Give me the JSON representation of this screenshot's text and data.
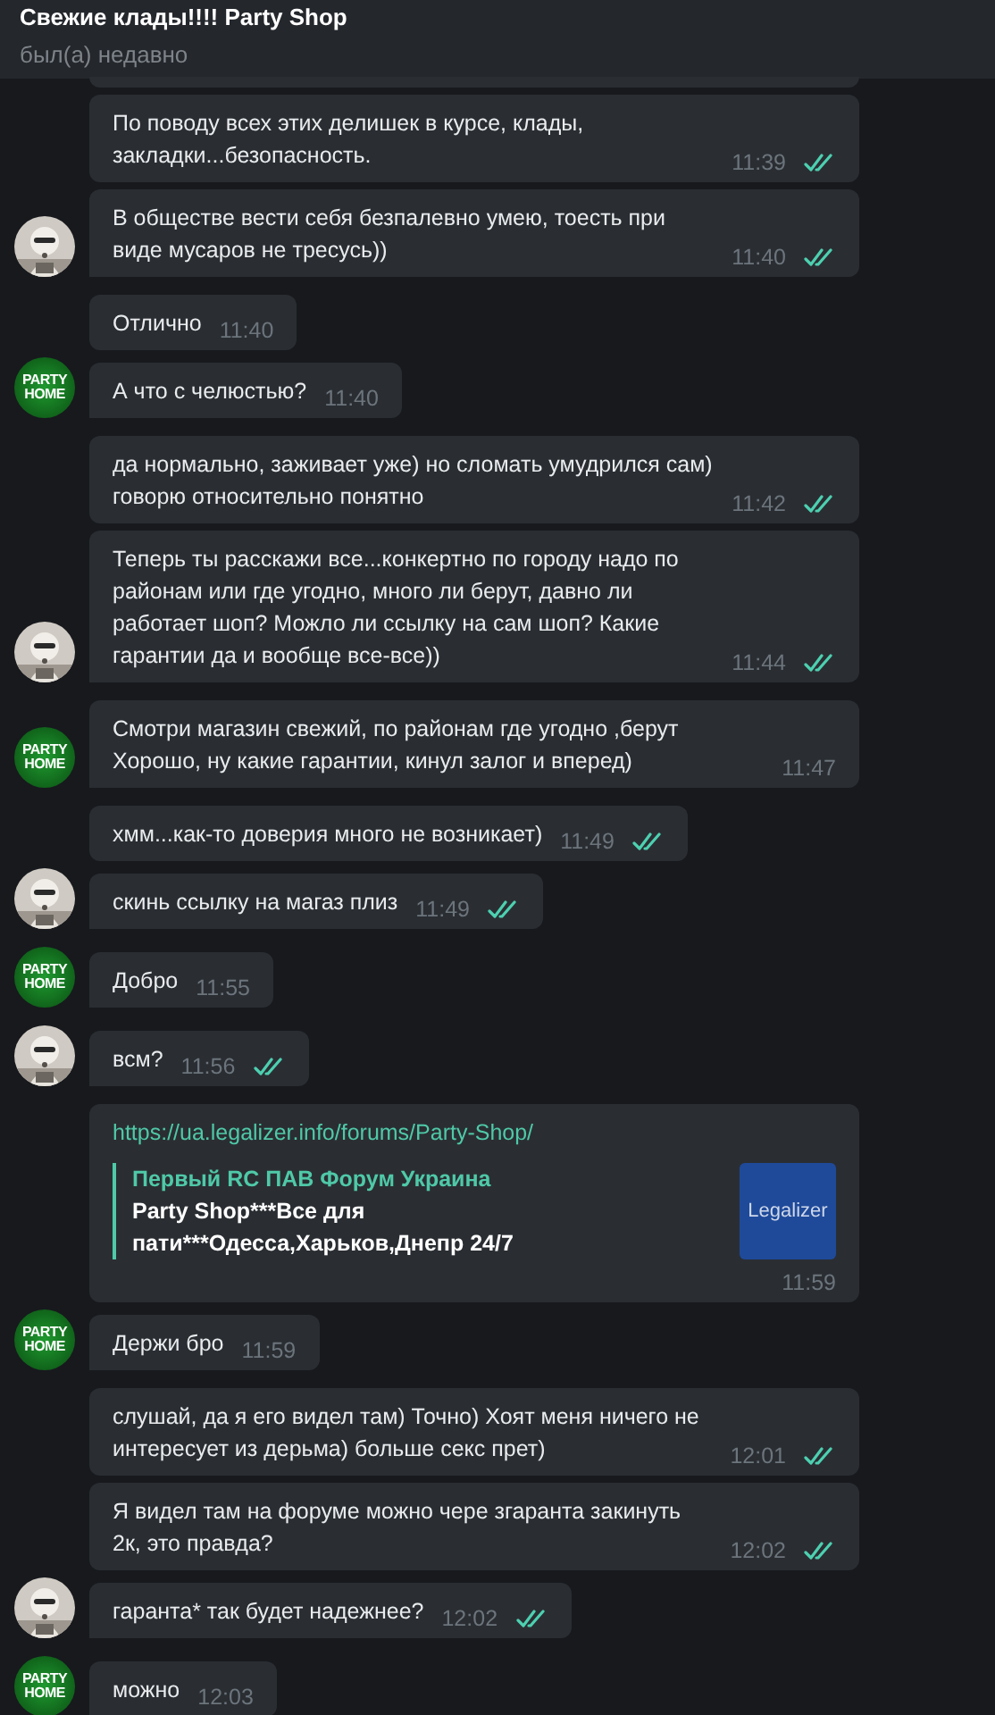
{
  "header": {
    "title": "Свежие клады!!!! Party Shop",
    "status": "был(а) недавно"
  },
  "messages": [
    {
      "kind": "outgoing",
      "text": "По поводу всех этих делишек в курсе, клады, закладки...безопасность.",
      "time": "11:39",
      "avatar": false
    },
    {
      "kind": "outgoing",
      "text": "В обществе вести себя безпалевно умею, тоесть при виде мусаров не тресусь))",
      "time": "11:40"
    },
    {
      "kind": "incoming",
      "text": "Отлично",
      "time": "11:40",
      "avatar": false
    },
    {
      "kind": "incoming",
      "text": "А что с челюстью?",
      "time": "11:40",
      "avatar": {
        "kind": "logo",
        "label": "PARTY HOME"
      }
    },
    {
      "kind": "outgoing",
      "text": "да нормально, заживает уже) но сломать умудрился сам) говорю относительно понятно",
      "time": "11:42",
      "avatar": false
    },
    {
      "kind": "outgoing",
      "text": "Теперь ты расскажи все...конкертно по городу надо по районам или где угодно, много ли берут, давно ли работает шоп? Можло ли ссылку на сам шоп? Какие гарантии да и вообще все-все))",
      "time": "11:44"
    },
    {
      "kind": "incoming",
      "text": "Смотри магазин свежий,  по районам где угодно ,берут Хорошо, ну какие гарантии, кинул залог и вперед)",
      "time": "11:47",
      "avatar": {
        "kind": "logo",
        "label": "PARTY HOME"
      }
    },
    {
      "kind": "outgoing",
      "text": "хмм...как-то доверия много не возникает)",
      "time": "11:49",
      "avatar": false
    },
    {
      "kind": "outgoing",
      "text": "скинь ссылку на магаз плиз",
      "time": "11:49"
    },
    {
      "kind": "incoming",
      "text": "Добро",
      "time": "11:55",
      "avatar": {
        "kind": "logo",
        "label": "PARTY HOME"
      }
    },
    {
      "kind": "outgoing",
      "text": "всм?",
      "time": "11:56"
    },
    {
      "kind": "incoming",
      "link": "https://ua.legalizer.info/forums/Party-Shop/",
      "preview": {
        "site": "Первый RC ПАВ Форум Украина",
        "title": "Party Shop***Все для пати***Одесса,Харьков,Днепр 24/7",
        "thumbnail_text": "Legalizer"
      },
      "time": "11:59",
      "avatar": false
    },
    {
      "kind": "incoming",
      "text": "Держи бро",
      "time": "11:59",
      "avatar": {
        "kind": "logo",
        "label": "PARTY HOME"
      }
    },
    {
      "kind": "outgoing",
      "text": "слушай, да я его видел там) Точно) Хоят меня ничего не интересует из дерьма) больше секс прет)",
      "time": "12:01",
      "avatar": false
    },
    {
      "kind": "outgoing",
      "text": "Я видел там на форуме можно чере згаранта закинуть 2к, это правда?",
      "time": "12:02",
      "avatar": false
    },
    {
      "kind": "outgoing",
      "text": "гаранта* так будет надежнее?",
      "time": "12:02"
    },
    {
      "kind": "incoming",
      "text": "можно",
      "time": "12:03",
      "avatar": {
        "kind": "logo",
        "label": "PARTY HOME"
      }
    }
  ]
}
